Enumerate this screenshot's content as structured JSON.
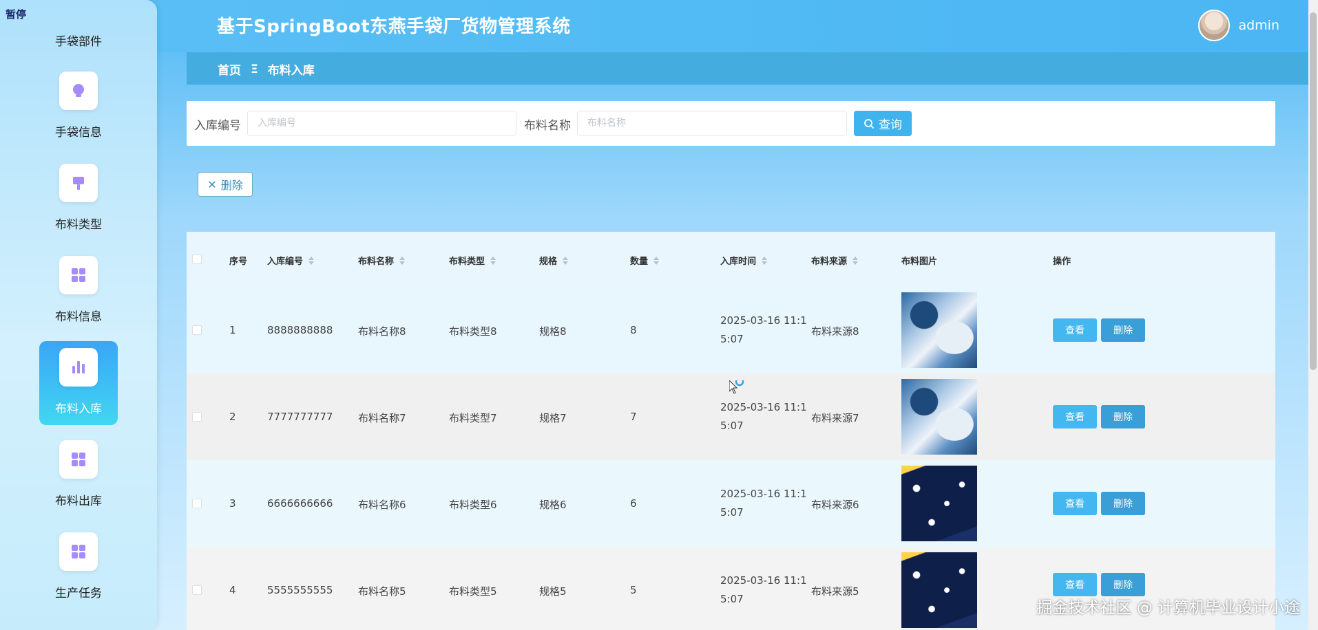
{
  "header": {
    "title": "基于SpringBoot东燕手袋厂货物管理系统",
    "user": "admin"
  },
  "breadcrumb": {
    "home": "首页",
    "separator": "Ξ",
    "current": "布料入库"
  },
  "sidebar": {
    "pause_tag": "暂停",
    "top_partial": "手袋部件",
    "items": [
      {
        "label": "手袋信息",
        "icon": "lightbulb-icon"
      },
      {
        "label": "布料类型",
        "icon": "brush-icon"
      },
      {
        "label": "布料信息",
        "icon": "grid-icon"
      },
      {
        "label": "布料入库",
        "icon": "bar-chart-icon",
        "active": true
      },
      {
        "label": "布料出库",
        "icon": "grid-icon"
      },
      {
        "label": "生产任务",
        "icon": "grid-icon"
      }
    ]
  },
  "search": {
    "field1_label": "入库编号",
    "field1_placeholder": "入库编号",
    "field2_label": "布料名称",
    "field2_placeholder": "布料名称",
    "button": "查询"
  },
  "toolbar": {
    "delete_label": "删除"
  },
  "table": {
    "columns": [
      "序号",
      "入库编号",
      "布料名称",
      "布料类型",
      "规格",
      "数量",
      "入库时间",
      "布料来源",
      "布料图片",
      "操作"
    ],
    "rows": [
      {
        "index": "1",
        "code": "8888888888",
        "name": "布料名称8",
        "type": "布料类型8",
        "spec": "规格8",
        "qty": "8",
        "time": "2025-03-16 11:15:07",
        "time_l1": "2025-03-16 11:1",
        "time_l2": "5:07",
        "source": "布料来源8",
        "image": "blue"
      },
      {
        "index": "2",
        "code": "7777777777",
        "name": "布料名称7",
        "type": "布料类型7",
        "spec": "规格7",
        "qty": "7",
        "time": "2025-03-16 11:15:07",
        "time_l1": "2025-03-16 11:1",
        "time_l2": "5:07",
        "source": "布料来源7",
        "image": "blue"
      },
      {
        "index": "3",
        "code": "6666666666",
        "name": "布料名称6",
        "type": "布料类型6",
        "spec": "规格6",
        "qty": "6",
        "time": "2025-03-16 11:15:07",
        "time_l1": "2025-03-16 11:1",
        "time_l2": "5:07",
        "source": "布料来源6",
        "image": "navy"
      },
      {
        "index": "4",
        "code": "5555555555",
        "name": "布料名称5",
        "type": "布料类型5",
        "spec": "规格5",
        "qty": "5",
        "time": "2025-03-16 11:15:07",
        "time_l1": "2025-03-16 11:1",
        "time_l2": "5:07",
        "source": "布料来源5",
        "image": "navy"
      }
    ],
    "view_label": "查看",
    "delete_label": "删除"
  },
  "watermark": "掘金技术社区 @ 计算机毕业设计小途",
  "colors": {
    "primary": "#45b7f0",
    "header": "#4ab6f3",
    "breadcrumb_bar": "#45ace0"
  }
}
